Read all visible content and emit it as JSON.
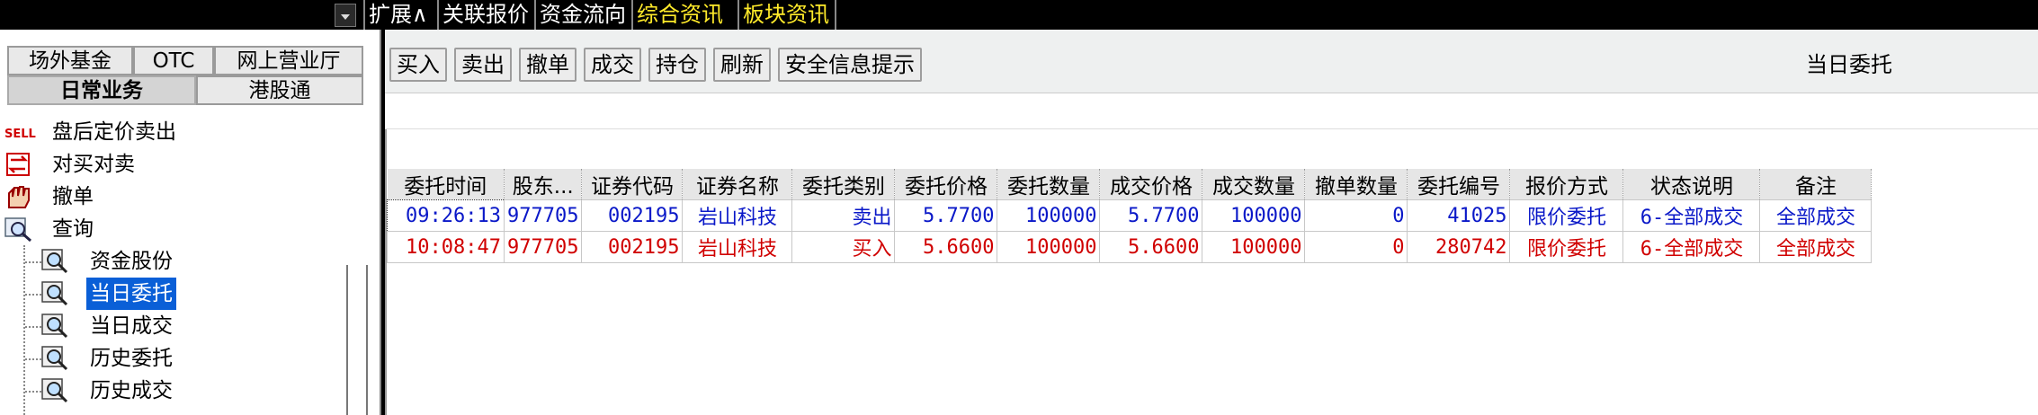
{
  "top_tabs": [
    {
      "label": "扩展∧",
      "color": "#ffffff"
    },
    {
      "label": "关联报价",
      "color": "#ffffff"
    },
    {
      "label": "资金流向",
      "color": "#ffffff"
    },
    {
      "label": "综合资讯",
      "color": "#ffea2a"
    },
    {
      "label": "板块资讯",
      "color": "#ffea2a"
    }
  ],
  "sidebar": {
    "tabs_row1": [
      "场外基金",
      "OTC",
      "网上营业厅"
    ],
    "tabs_row2": [
      "日常业务",
      "港股通"
    ],
    "active_tab": "日常业务",
    "items": [
      {
        "label": "盘后定价卖出",
        "icon": "sell-icon"
      },
      {
        "label": "对买对卖",
        "icon": "swap-icon"
      },
      {
        "label": "撤单",
        "icon": "hand-icon"
      },
      {
        "label": "查询",
        "icon": "query-icon"
      }
    ],
    "sub_items": [
      {
        "label": "资金股份",
        "icon": "magnifier-icon"
      },
      {
        "label": "当日委托",
        "icon": "magnifier-icon",
        "selected": true
      },
      {
        "label": "当日成交",
        "icon": "magnifier-icon"
      },
      {
        "label": "历史委托",
        "icon": "magnifier-icon"
      },
      {
        "label": "历史成交",
        "icon": "magnifier-icon"
      }
    ]
  },
  "toolbar": {
    "buttons": [
      "买入",
      "卖出",
      "撤单",
      "成交",
      "持仓",
      "刷新",
      "安全信息提示"
    ],
    "title": "当日委托"
  },
  "table": {
    "columns": [
      "委托时间",
      "股东...",
      "证券代码",
      "证券名称",
      "委托类别",
      "委托价格",
      "委托数量",
      "成交价格",
      "成交数量",
      "撤单数量",
      "委托编号",
      "报价方式",
      "状态说明",
      "备注"
    ],
    "rows": [
      {
        "type": "sell",
        "cells": [
          "09:26:13",
          "977705",
          "002195",
          "岩山科技",
          "卖出",
          "5.7700",
          "100000",
          "5.7700",
          "100000",
          "0",
          "41025",
          "限价委托",
          "6-全部成交",
          "全部成交"
        ]
      },
      {
        "type": "buy",
        "cells": [
          "10:08:47",
          "977705",
          "002195",
          "岩山科技",
          "买入",
          "5.6600",
          "100000",
          "5.6600",
          "100000",
          "0",
          "280742",
          "限价委托",
          "6-全部成交",
          "全部成交"
        ]
      }
    ]
  },
  "colors": {
    "sell_text": "#0a18c8",
    "buy_text": "#d00000",
    "selection": "#0a5fd7",
    "top_yellow": "#ffea2a"
  }
}
